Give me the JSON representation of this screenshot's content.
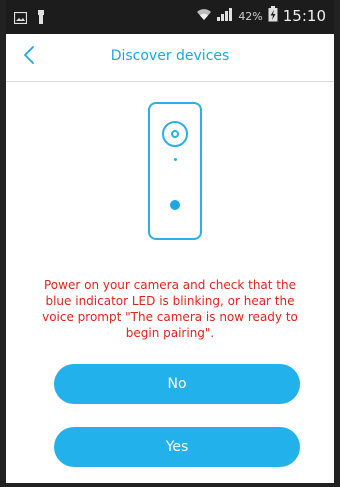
{
  "status_bar": {
    "battery_percent": "42%",
    "time": "15:10",
    "icons": [
      "image-icon",
      "usb-icon",
      "wifi-icon",
      "signal-icon",
      "battery-charging-icon"
    ]
  },
  "header": {
    "title": "Discover devices",
    "back_icon": "chevron-left-icon"
  },
  "main": {
    "illustration_icon": "camera-device-icon",
    "instruction": "Power on your camera and check that the blue indicator LED is blinking, or hear the voice prompt \"The camera is now ready to begin pairing\".",
    "buttons": {
      "no_label": "No",
      "yes_label": "Yes"
    }
  },
  "colors": {
    "accent": "#23b1eb",
    "warning_text": "#e0251b",
    "status_bar_bg": "#1c1c1c"
  }
}
